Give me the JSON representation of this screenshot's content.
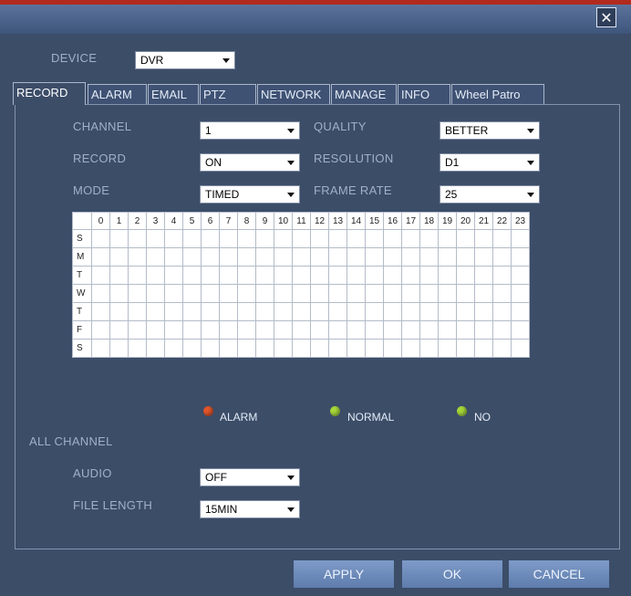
{
  "window": {
    "close_icon": "close-x-icon"
  },
  "device": {
    "label": "DEVICE",
    "value": "DVR"
  },
  "tabs": [
    "RECORD",
    "ALARM",
    "EMAIL",
    "PTZ",
    "NETWORK",
    "MANAGE",
    "INFO",
    "Wheel Patro"
  ],
  "active_tab": "RECORD",
  "record": {
    "channel": {
      "label": "CHANNEL",
      "value": "1"
    },
    "record": {
      "label": "RECORD",
      "value": "ON"
    },
    "mode": {
      "label": "MODE",
      "value": "TIMED"
    },
    "quality": {
      "label": "QUALITY",
      "value": "BETTER"
    },
    "resolution": {
      "label": "RESOLUTION",
      "value": "D1"
    },
    "frame_rate": {
      "label": "FRAME RATE",
      "value": "25"
    }
  },
  "schedule": {
    "hours": [
      "0",
      "1",
      "2",
      "3",
      "4",
      "5",
      "6",
      "7",
      "8",
      "9",
      "10",
      "11",
      "12",
      "13",
      "14",
      "15",
      "16",
      "17",
      "18",
      "19",
      "20",
      "21",
      "22",
      "23"
    ],
    "days": [
      "S",
      "M",
      "T",
      "W",
      "T",
      "F",
      "S"
    ]
  },
  "legend": [
    {
      "label": "ALARM",
      "color": "#e0552a"
    },
    {
      "label": "NORMAL",
      "color": "#a6d63a"
    },
    {
      "label": "NO",
      "color": "#a6d63a"
    }
  ],
  "all_channel": {
    "label": "ALL CHANNEL",
    "audio": {
      "label": "AUDIO",
      "value": "OFF"
    },
    "file_length": {
      "label": "FILE LENGTH",
      "value": "15MIN"
    }
  },
  "buttons": {
    "apply": "APPLY",
    "ok": "OK",
    "cancel": "CANCEL"
  }
}
